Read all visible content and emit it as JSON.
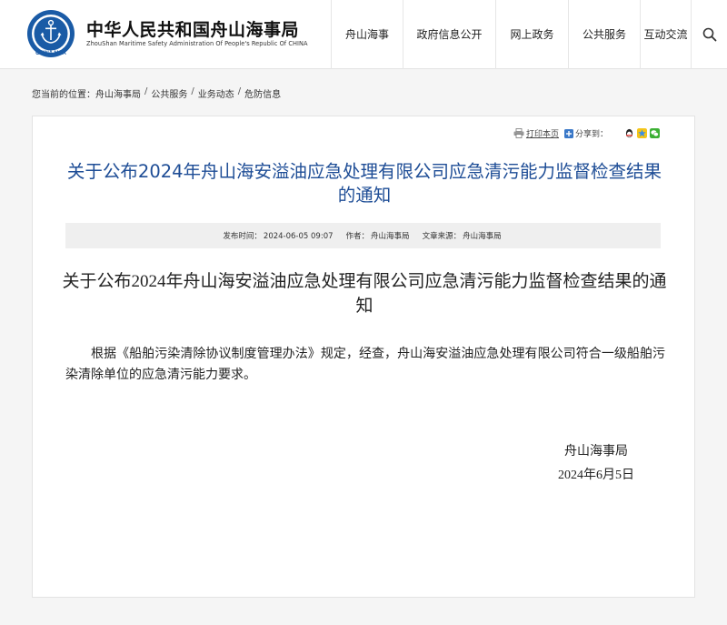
{
  "header": {
    "title": "中华人民共和国舟山海事局",
    "subtitle": "ZhouShan Maritime Safety Administration Of People's Republic Of CHINA",
    "logo_text": "CHINA MSA",
    "nav": [
      {
        "label": "舟山海事"
      },
      {
        "label": "政府信息公开"
      },
      {
        "label": "网上政务"
      },
      {
        "label": "公共服务"
      },
      {
        "label": "互动交流"
      }
    ],
    "search_icon": "search-icon",
    "brand_color": "#1a5ba6"
  },
  "breadcrumb": {
    "prefix": "您当前的位置：",
    "items": [
      "舟山海事局",
      "公共服务",
      "业务动态",
      "危防信息"
    ],
    "separator": "/"
  },
  "tools": {
    "print_label": "打印本页",
    "share_label": "分享到：",
    "share_icons": [
      "qq-icon",
      "qzone-icon",
      "wechat-icon"
    ]
  },
  "article": {
    "title": "关于公布2024年舟山海安溢油应急处理有限公司应急清污能力监督检查结果的通知",
    "meta": {
      "publish_label": "发布时间：",
      "publish_value": "2024-06-05 09:07",
      "author_label": "作者：",
      "author_value": "舟山海事局",
      "source_label": "文章来源：",
      "source_value": "舟山海事局"
    },
    "body_heading": "关于公布2024年舟山海安溢油应急处理有限公司应急清污能力监督检查结果的通知",
    "paragraph": "根据《船舶污染清除协议制度管理办法》规定，经查，舟山海安溢油应急处理有限公司符合一级船舶污染清除单位的应急清污能力要求。",
    "signature_org": "舟山海事局",
    "signature_date": "2024年6月5日",
    "title_color": "#1e4d96"
  }
}
